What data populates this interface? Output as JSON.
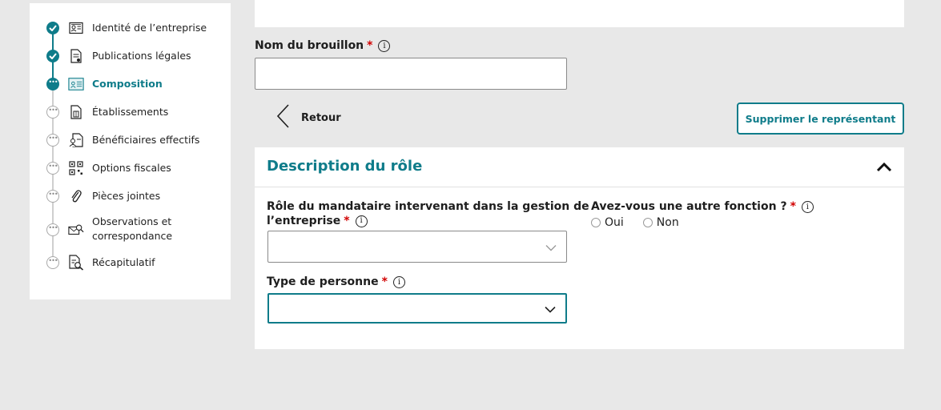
{
  "sidebar": {
    "steps": [
      {
        "label": "Identité de l’entreprise",
        "state": "done",
        "icon": "id-card-icon"
      },
      {
        "label": "Publications légales",
        "state": "done",
        "icon": "document-stamp-icon"
      },
      {
        "label": "Composition",
        "state": "current",
        "icon": "org-chart-icon"
      },
      {
        "label": "Établissements",
        "state": "todo",
        "icon": "building-doc-icon"
      },
      {
        "label": "Bénéficiaires effectifs",
        "state": "todo",
        "icon": "person-doc-icon"
      },
      {
        "label": "Options fiscales",
        "state": "todo",
        "icon": "qr-grid-icon"
      },
      {
        "label": "Pièces jointes",
        "state": "todo",
        "icon": "paperclip-icon"
      },
      {
        "label": "Observations et correspondance",
        "state": "todo",
        "icon": "envelope-search-icon"
      },
      {
        "label": "Récapitulatif",
        "state": "todo",
        "icon": "doc-search-icon"
      }
    ]
  },
  "draft": {
    "label": "Nom du brouillon",
    "required_mark": "*",
    "value": "",
    "placeholder": ""
  },
  "back": {
    "label": "Retour"
  },
  "delete_button": {
    "label": "Supprimer le représentant"
  },
  "panel": {
    "title": "Description du rôle",
    "role_field": {
      "label_line1": "Rôle du mandataire intervenant dans la gestion de",
      "label_line2": "l’entreprise",
      "required_mark": "*",
      "selected": ""
    },
    "other_function": {
      "label": "Avez-vous une autre fonction ?",
      "required_mark": "*",
      "options": [
        "Oui",
        "Non"
      ]
    },
    "person_type": {
      "label": "Type de personne",
      "required_mark": "*",
      "selected": ""
    }
  },
  "colors": {
    "accent": "#0f7c8a",
    "required": "#d10000",
    "background": "#e8e8e8"
  }
}
